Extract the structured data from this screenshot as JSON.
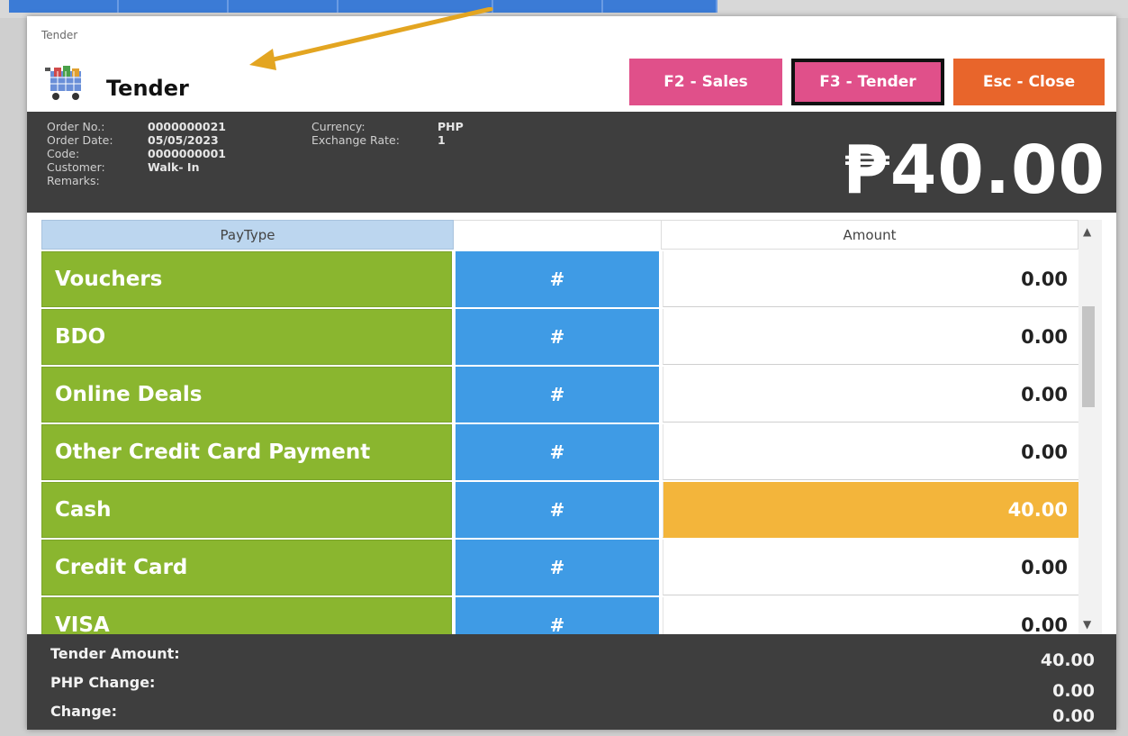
{
  "window": {
    "title": "Tender"
  },
  "header": {
    "title": "Tender",
    "icon": "shopping-cart-icon"
  },
  "buttons": {
    "sales": "F2 - Sales",
    "tender": "F3 - Tender",
    "close": "Esc - Close"
  },
  "order_info": {
    "order_no_label": "Order No.:",
    "order_no": "0000000021",
    "order_date_label": "Order Date:",
    "order_date": "05/05/2023",
    "code_label": "Code:",
    "code": "0000000001",
    "customer_label": "Customer:",
    "customer": "Walk- In",
    "remarks_label": "Remarks:",
    "currency_label": "Currency:",
    "currency": "PHP",
    "exchange_rate_label": "Exchange Rate:",
    "exchange_rate": "1"
  },
  "total": "₱40.00",
  "grid": {
    "columns": {
      "paytype": "PayType",
      "blank": "",
      "amount": "Amount"
    },
    "rows": [
      {
        "paytype": "Vouchers",
        "hash": "#",
        "amount": "0.00"
      },
      {
        "paytype": "BDO",
        "hash": "#",
        "amount": "0.00"
      },
      {
        "paytype": "Online Deals",
        "hash": "#",
        "amount": "0.00"
      },
      {
        "paytype": "Other Credit Card Payment",
        "hash": "#",
        "amount": "0.00"
      },
      {
        "paytype": "Cash",
        "hash": "#",
        "amount": "40.00"
      },
      {
        "paytype": "Credit Card",
        "hash": "#",
        "amount": "0.00"
      },
      {
        "paytype": "VISA",
        "hash": "#",
        "amount": "0.00"
      }
    ]
  },
  "footer": {
    "tender_amount_label": "Tender Amount:",
    "tender_amount": "40.00",
    "php_change_label": "PHP Change:",
    "php_change": "0.00",
    "change_label": "Change:",
    "change": "0.00"
  },
  "colors": {
    "paytype_green": "#8ab62f",
    "hash_blue": "#3f9be5",
    "selected_orange": "#f3b53b",
    "button_pink": "#e0508a",
    "button_orange": "#e8652b",
    "dark_panel": "#3e3e3e"
  }
}
